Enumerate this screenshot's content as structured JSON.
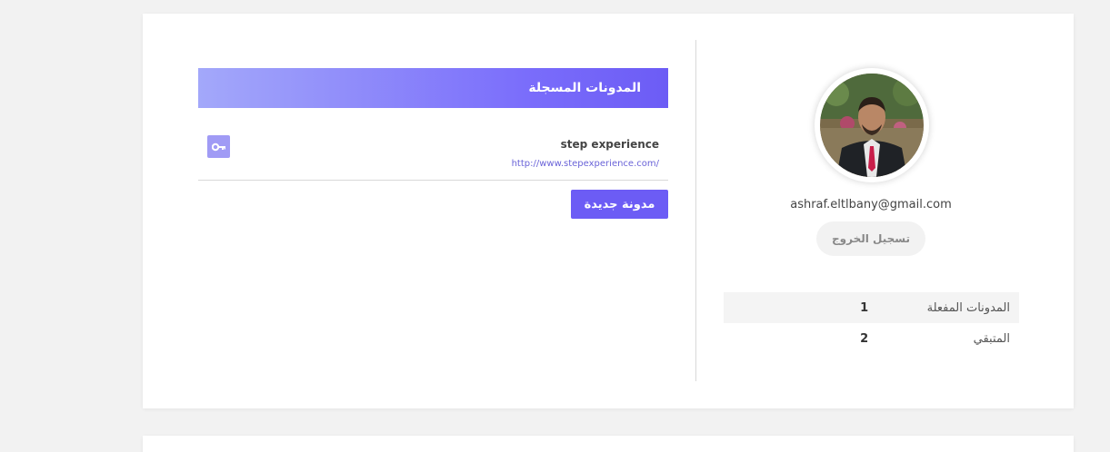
{
  "profile": {
    "email": "ashraf.eltlbany@gmail.com",
    "logout_label": "تسجيل الخروج"
  },
  "stats": [
    {
      "label": "المدونات المفعلة",
      "value": "1"
    },
    {
      "label": "المتبقي",
      "value": "2"
    }
  ],
  "blogs_panel": {
    "title": "المدونات المسجلة",
    "items": [
      {
        "name": "step experience",
        "url": "http://www.stepexperience.com/"
      }
    ],
    "new_blog_label": "مدونة جديدة"
  },
  "colors": {
    "accent": "#6c5cf5",
    "header_gradient_start": "#a3a8fa",
    "header_gradient_end": "#6c5cf5",
    "page_background": "#f2f2f2"
  }
}
